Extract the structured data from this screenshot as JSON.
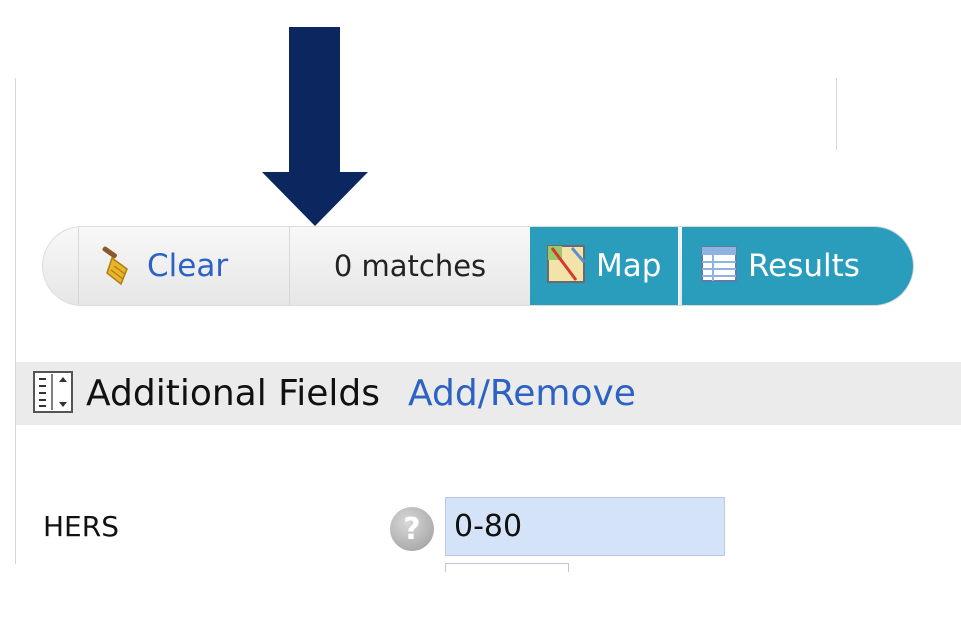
{
  "toolbar": {
    "clear_label": "Clear",
    "matches_text": "0 matches",
    "map_label": "Map",
    "results_label": "Results"
  },
  "fields": {
    "title": "Additional Fields",
    "add_remove_label": "Add/Remove"
  },
  "hers": {
    "label": "HERS",
    "value": "0-80",
    "help_glyph": "?"
  },
  "icons": {
    "clear": "broom-icon",
    "map": "map-icon",
    "results": "table-icon",
    "fields": "list-icon",
    "help": "question-icon"
  },
  "colors": {
    "arrow": "#0c2660",
    "accent": "#2a9dbd",
    "link": "#2c62c4",
    "input_bg": "#d4e3f7"
  }
}
